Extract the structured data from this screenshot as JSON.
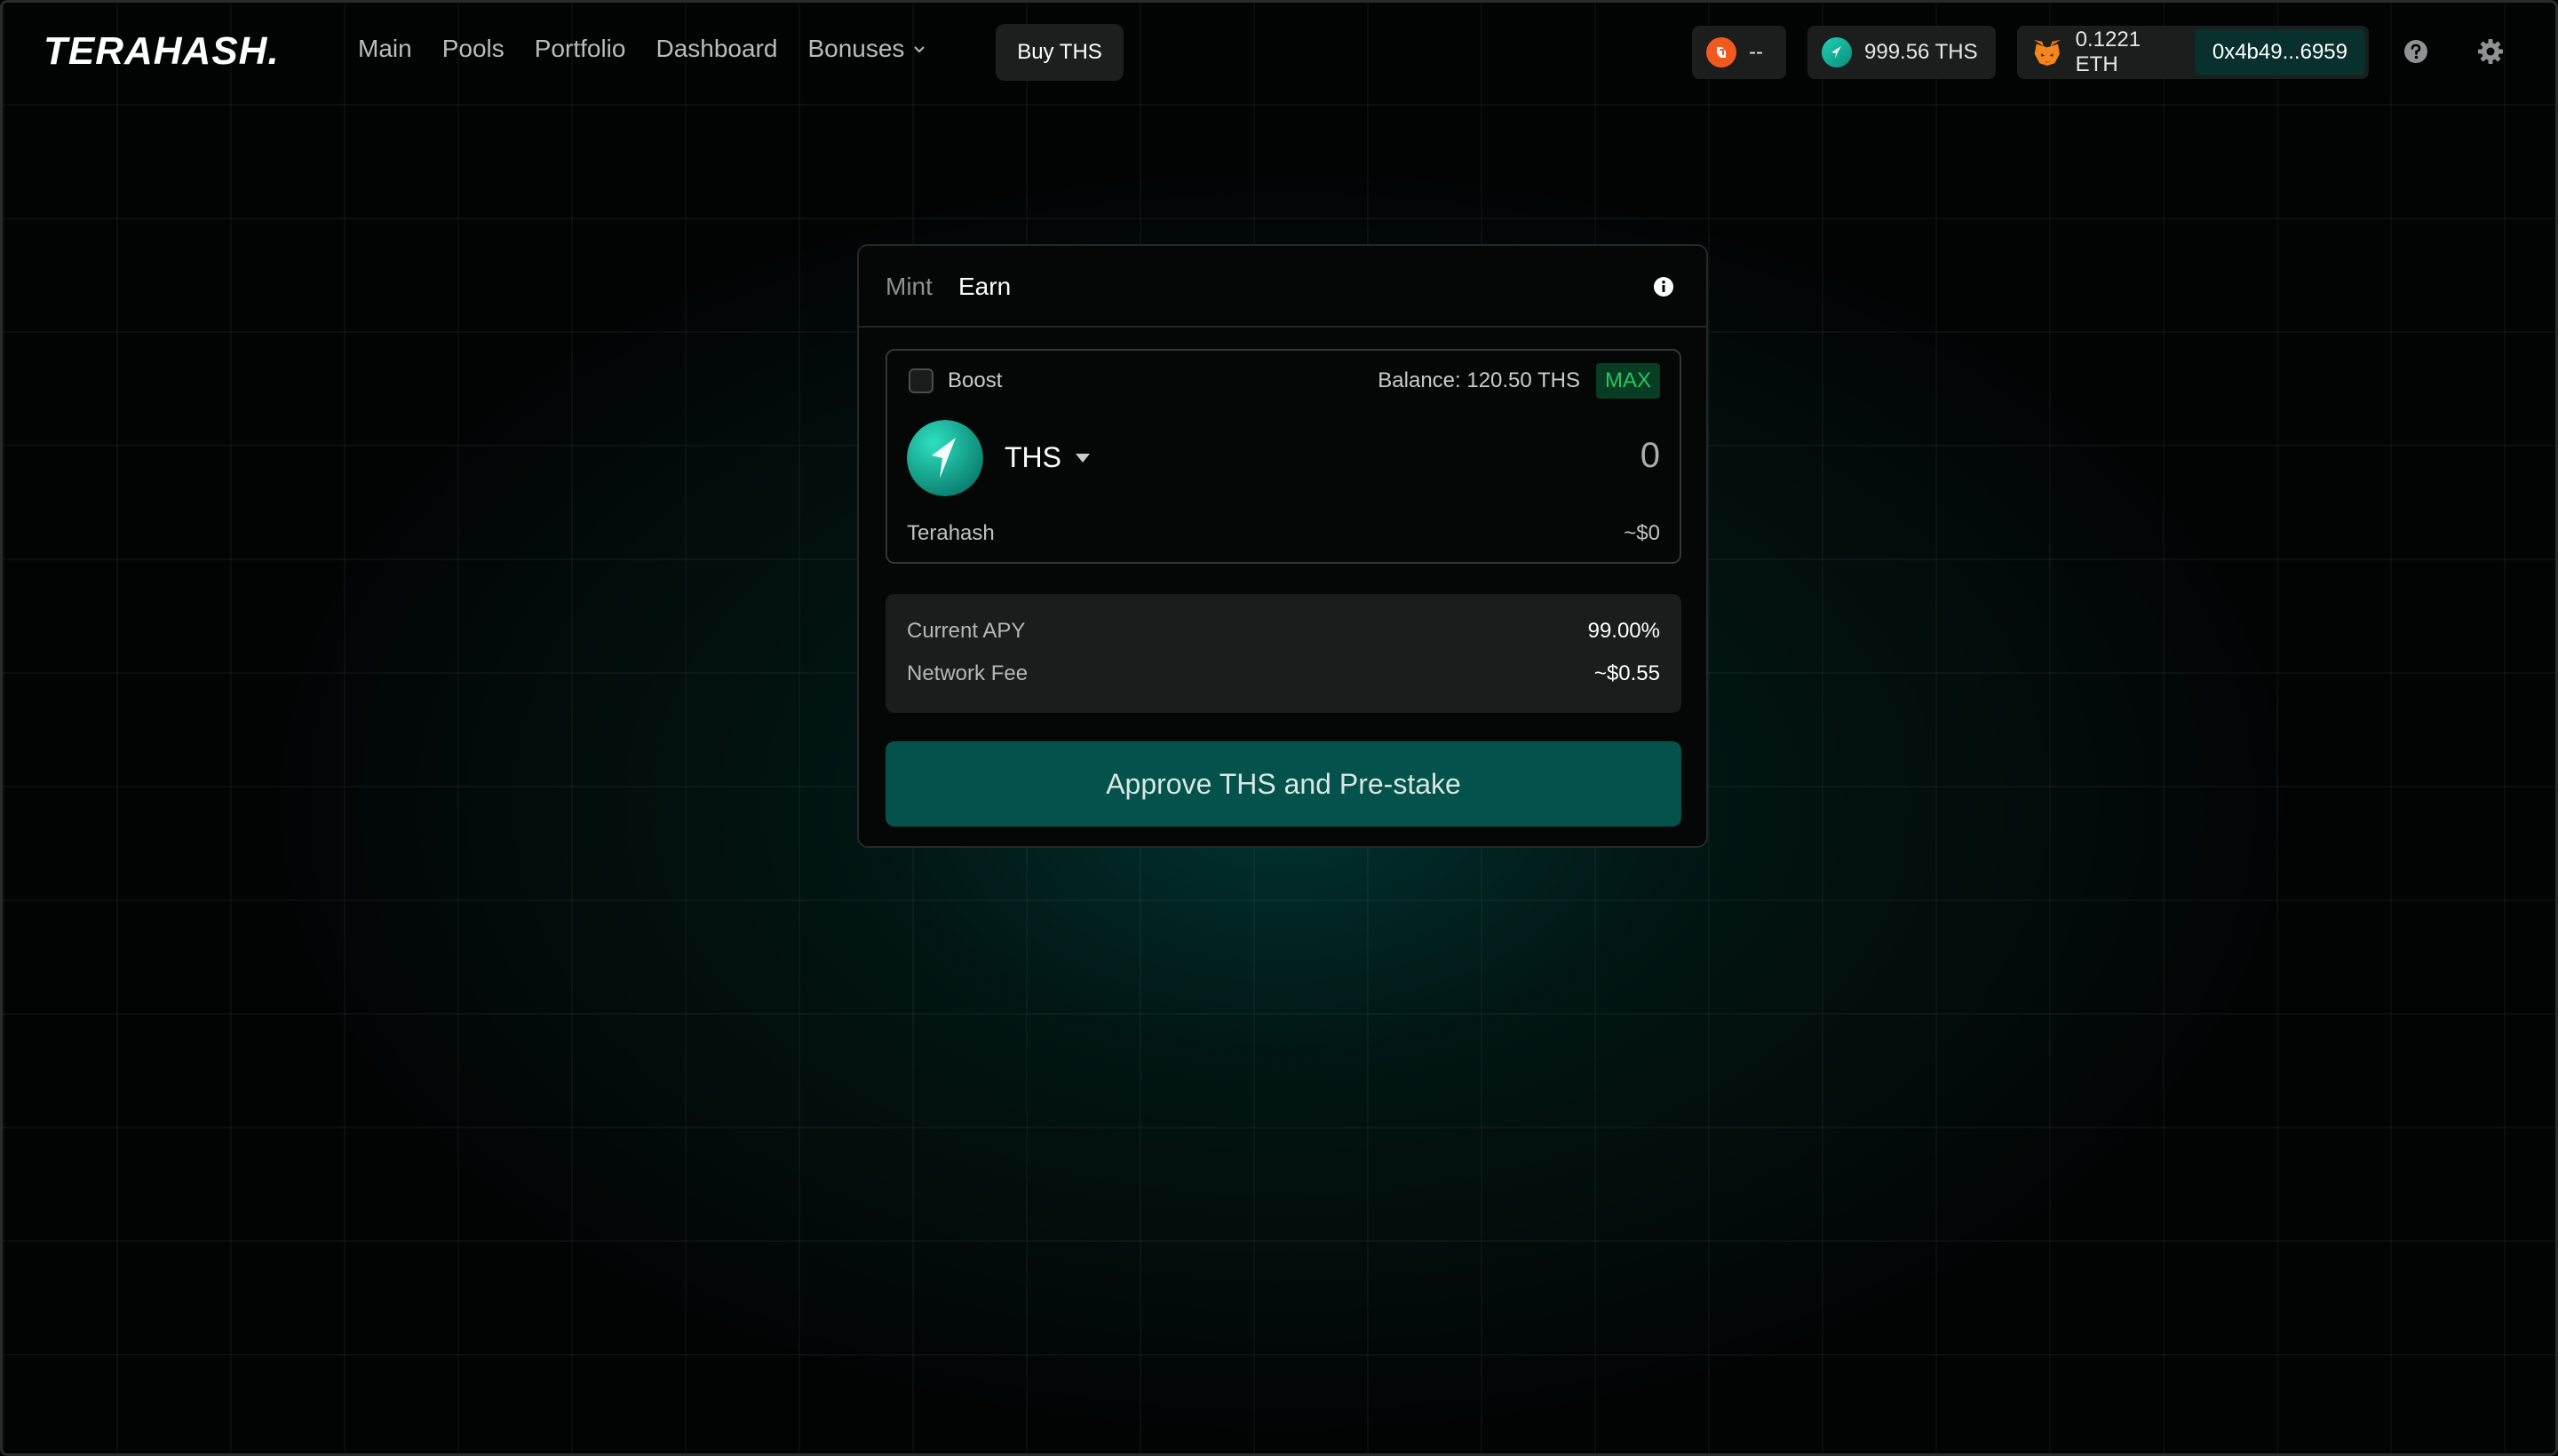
{
  "header": {
    "logo": "TERAHASH.",
    "nav": [
      "Main",
      "Pools",
      "Portfolio",
      "Dashboard",
      "Bonuses"
    ],
    "buy_label": "Buy THS",
    "points_value": "--",
    "ths_balance": "999.56 THS",
    "eth_balance": "0.1221 ETH",
    "address": "0x4b49...6959"
  },
  "tabs": {
    "mint": "Mint",
    "earn": "Earn",
    "active": "Earn"
  },
  "input": {
    "boost_label": "Boost",
    "balance": "Balance: 120.50 THS",
    "max_label": "MAX",
    "token_symbol": "THS",
    "amount": "0",
    "token_name": "Terahash",
    "usd_value": "~$0"
  },
  "info": {
    "apy_label": "Current APY",
    "apy_value": "99.00%",
    "fee_label": "Network Fee",
    "fee_value": "~$0.55"
  },
  "approve_label": "Approve THS and Pre-stake",
  "colors": {
    "accent": "#03524b",
    "max_green": "#25c55e",
    "ths_teal": "#1fd1b4",
    "points_orange": "#f05a1e"
  }
}
